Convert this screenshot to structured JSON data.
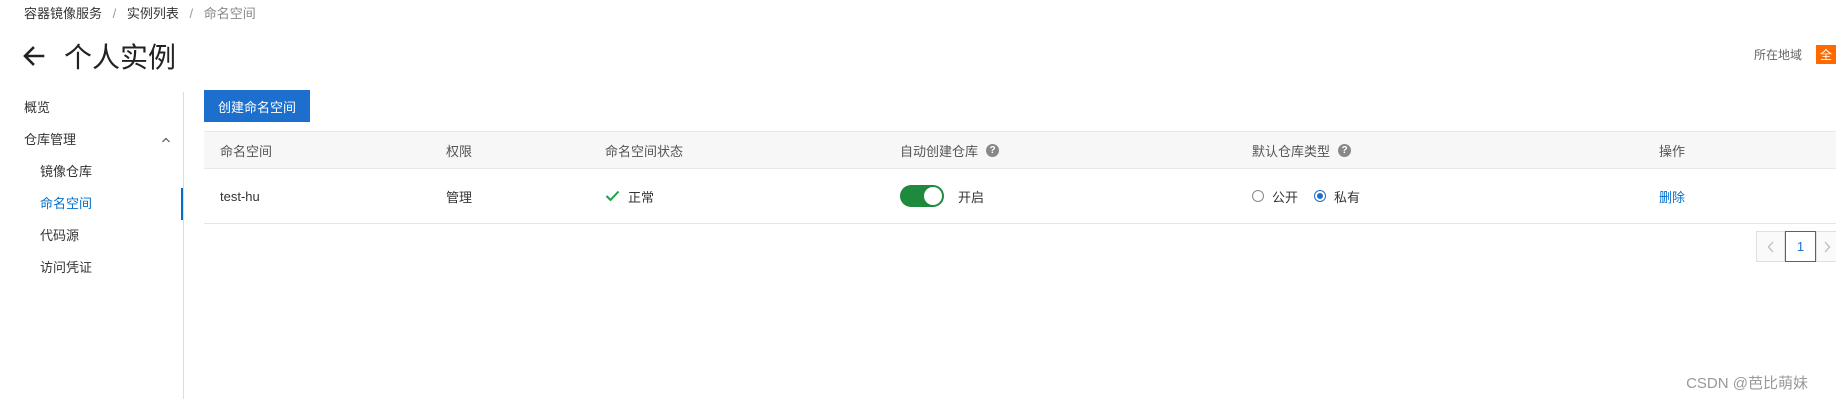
{
  "breadcrumb": {
    "items": [
      "容器镜像服务",
      "实例列表"
    ],
    "separator": "/",
    "current": "命名空间"
  },
  "header": {
    "title": "个人实例",
    "back_icon": "arrow-left-icon"
  },
  "region": {
    "label": "所在地域",
    "badge": "全"
  },
  "sidebar": {
    "items": [
      {
        "label": "概览",
        "level": "top"
      },
      {
        "label": "仓库管理",
        "level": "top",
        "expanded": true
      },
      {
        "label": "镜像仓库",
        "level": "sub"
      },
      {
        "label": "命名空间",
        "level": "sub",
        "active": true
      },
      {
        "label": "代码源",
        "level": "sub"
      },
      {
        "label": "访问凭证",
        "level": "sub"
      }
    ]
  },
  "toolbar": {
    "create_label": "创建命名空间"
  },
  "table": {
    "headers": {
      "namespace": "命名空间",
      "permission": "权限",
      "status": "命名空间状态",
      "auto_create": "自动创建仓库",
      "default_type": "默认仓库类型",
      "action": "操作"
    },
    "rows": [
      {
        "namespace": "test-hu",
        "permission": "管理",
        "status": "正常",
        "auto_create_on": true,
        "auto_create_label": "开启",
        "type_options": [
          "公开",
          "私有"
        ],
        "type_selected": "私有",
        "action": "删除"
      }
    ]
  },
  "pagination": {
    "current_page": "1"
  },
  "watermark": "CSDN @芭比萌妹",
  "colors": {
    "primary": "#1d6fce",
    "link": "#0070cc",
    "success": "#1e8a3e",
    "region_badge": "#ff6a00"
  }
}
